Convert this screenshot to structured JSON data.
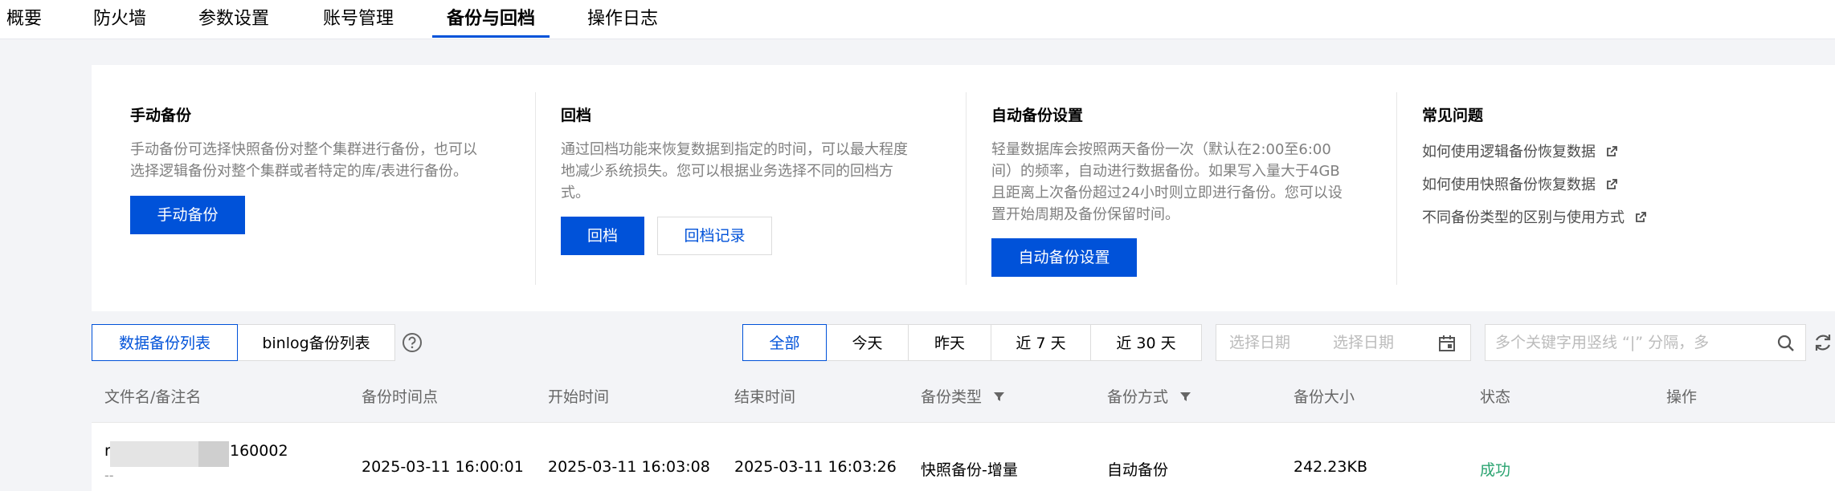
{
  "tabs": [
    {
      "label": "概要",
      "active": false
    },
    {
      "label": "防火墙",
      "active": false
    },
    {
      "label": "参数设置",
      "active": false
    },
    {
      "label": "账号管理",
      "active": false
    },
    {
      "label": "备份与回档",
      "active": true
    },
    {
      "label": "操作日志",
      "active": false
    }
  ],
  "cards": {
    "manual": {
      "title": "手动备份",
      "desc": [
        "手动备份可选择快照备份对整个集群进行备份，也可以",
        "选择逻辑备份对整个集群或者特定的库/表进行备份。"
      ],
      "button": "手动备份"
    },
    "rollback": {
      "title": "回档",
      "desc": [
        "通过回档功能来恢复数据到指定的时间，可以最大程度",
        "地减少系统损失。您可以根据业务选择不同的回档方",
        "式。"
      ],
      "button": "回档",
      "button2": "回档记录"
    },
    "auto": {
      "title": "自动备份设置",
      "desc": [
        "轻量数据库会按照两天备份一次（默认在2:00至6:00",
        "间）的频率，自动进行数据备份。如果写入量大于4GB",
        "且距离上次备份超过24小时则立即进行备份。您可以设",
        "置开始周期及备份保留时间。"
      ],
      "button": "自动备份设置"
    },
    "faq": {
      "title": "常见问题",
      "links": [
        "如何使用逻辑备份恢复数据",
        "如何使用快照备份恢复数据",
        "不同备份类型的区别与使用方式"
      ]
    }
  },
  "list_tabs": [
    {
      "label": "数据备份列表",
      "active": true
    },
    {
      "label": "binlog备份列表",
      "active": false
    }
  ],
  "time_filters": [
    {
      "label": "全部",
      "active": true
    },
    {
      "label": "今天",
      "active": false
    },
    {
      "label": "昨天",
      "active": false
    },
    {
      "label": "近 7 天",
      "active": false
    },
    {
      "label": "近 30 天",
      "active": false
    }
  ],
  "date_range": {
    "start_placeholder": "选择日期",
    "end_placeholder": "选择日期"
  },
  "search": {
    "placeholder": "多个关键字用竖线 “|” 分隔，多"
  },
  "columns": [
    "文件名/备注名",
    "备份时间点",
    "开始时间",
    "结束时间",
    "备份类型",
    "备份方式",
    "备份大小",
    "状态",
    "操作"
  ],
  "rows": [
    {
      "filename_prefix": "r",
      "filename_suffix": "160002",
      "remark": "--",
      "backup_point": "2025-03-11 16:00:01",
      "start_time": "2025-03-11 16:03:08",
      "end_time": "2025-03-11 16:03:26",
      "type": "快照备份-增量",
      "method": "自动备份",
      "size": "242.23KB",
      "status": "成功"
    }
  ],
  "colors": {
    "primary": "#0052d9",
    "success": "#2ba471",
    "background": "#f3f4f7"
  }
}
